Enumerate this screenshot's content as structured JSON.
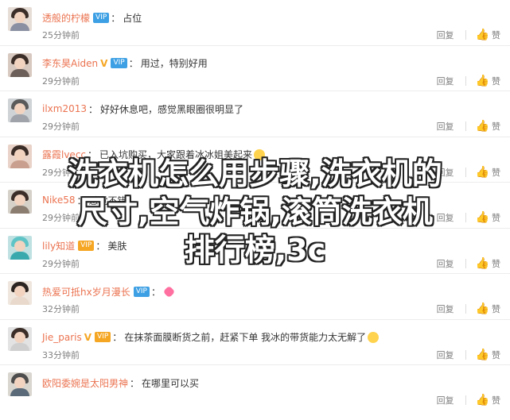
{
  "comments": [
    {
      "username": "透般的柠檬",
      "badge": "vip",
      "text": "占位",
      "time": "25分钟前",
      "reply": "回复",
      "like": "赞"
    },
    {
      "username": "李东昊Aiden",
      "badge": "vip-v",
      "text": "用过，特别好用",
      "time": "29分钟前",
      "reply": "回复",
      "like": "赞"
    },
    {
      "username": "ilxm2013",
      "badge": "",
      "text": "好好休息吧，感觉黑眼圈很明显了",
      "time": "29分钟前",
      "reply": "回复",
      "like": "赞"
    },
    {
      "username": "露霞lvecc",
      "badge": "",
      "text": "已入坑购买，大家跟着冰冰姐美起来",
      "time": "29分钟前",
      "reply": "回复",
      "like": "赞"
    },
    {
      "username": "Nike58",
      "badge": "",
      "text": "感觉不错",
      "time": "29分钟前",
      "reply": "回复",
      "like": "赞"
    },
    {
      "username": "lily知道",
      "badge": "",
      "text": "美肤",
      "time": "29分钟前",
      "reply": "回复",
      "like": "赞"
    },
    {
      "username": "热爱可抵hx岁月漫长",
      "badge": "vip",
      "text": "",
      "time": "32分钟前",
      "reply": "回复",
      "like": "赞"
    },
    {
      "username": "Jie_paris",
      "badge": "vip-v",
      "text": "在抹茶面膜断货之前，赶紧下单   我冰的带货能力太无解了",
      "time": "33分钟前",
      "reply": "回复",
      "like": "赞"
    },
    {
      "username": "欧阳委婉是太阳男神",
      "badge": "",
      "text": "在哪里可以买",
      "time": "",
      "reply": "回复",
      "like": "赞"
    }
  ],
  "overlay_title": {
    "line1": "洗衣机怎么用步骤,洗衣机的",
    "line2": "尺寸,空气炸锅,滚筒洗衣机",
    "line3": "排行榜,3c"
  },
  "colors": {
    "username": "#eb7350",
    "vip_blue": "#3ea0e4",
    "vip_gold": "#f5a623",
    "meta_gray": "#808080"
  },
  "icons": {
    "like": "thumbs-up-icon",
    "vip": "vip-badge-icon"
  }
}
